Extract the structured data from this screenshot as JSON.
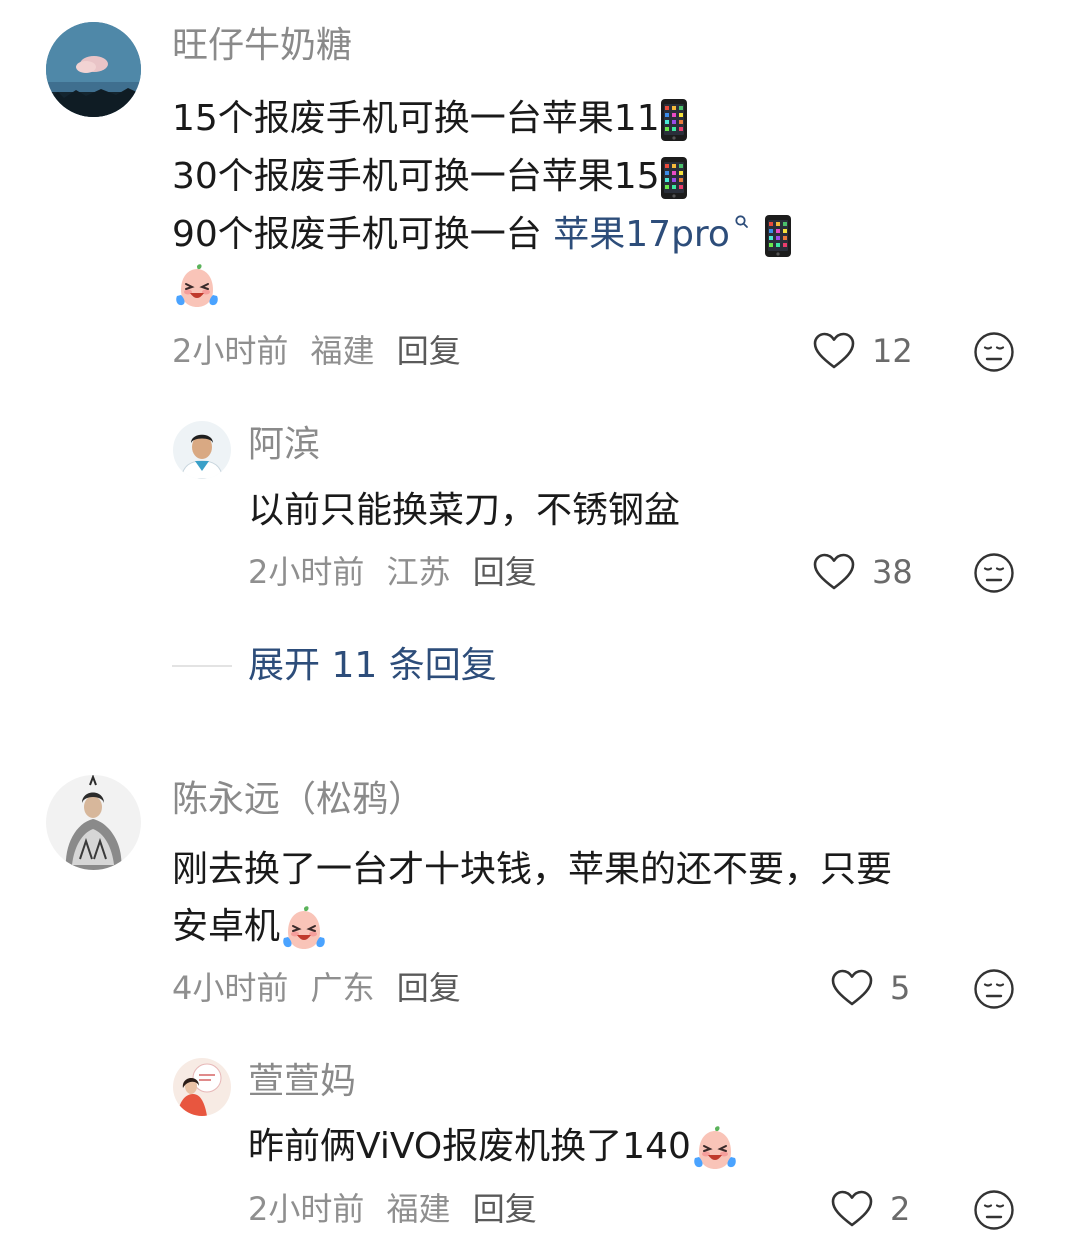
{
  "comments": [
    {
      "author": "旺仔牛奶糖",
      "lines": [
        "15个报废手机可换一台苹果11",
        "30个报废手机可换一台苹果15",
        "90个报废手机可换一台 "
      ],
      "link_text": "苹果17pro",
      "time": "2小时前",
      "location": "福建",
      "reply_label": "回复",
      "likes": "12",
      "replies": [
        {
          "author": "阿滨",
          "text": "以前只能换菜刀，不锈钢盆",
          "time": "2小时前",
          "location": "江苏",
          "reply_label": "回复",
          "likes": "38"
        }
      ],
      "expand_label": "展开 11 条回复"
    },
    {
      "author": "陈永远（松鸦）",
      "lines": [
        "刚去换了一台才十块钱，苹果的还不要，只要",
        "安卓机"
      ],
      "time": "4小时前",
      "location": "广东",
      "reply_label": "回复",
      "likes": "5",
      "replies": [
        {
          "author": "萱萱妈",
          "text": "昨前俩ViVO报废机换了140",
          "time": "2小时前",
          "location": "福建",
          "reply_label": "回复",
          "likes": "2"
        }
      ]
    }
  ],
  "icons": {
    "phone": "mobile-phone-icon",
    "emoji": "crying-laughing-emoji-icon",
    "search": "search-icon",
    "like": "heart-icon",
    "dislike": "dislike-face-icon"
  }
}
